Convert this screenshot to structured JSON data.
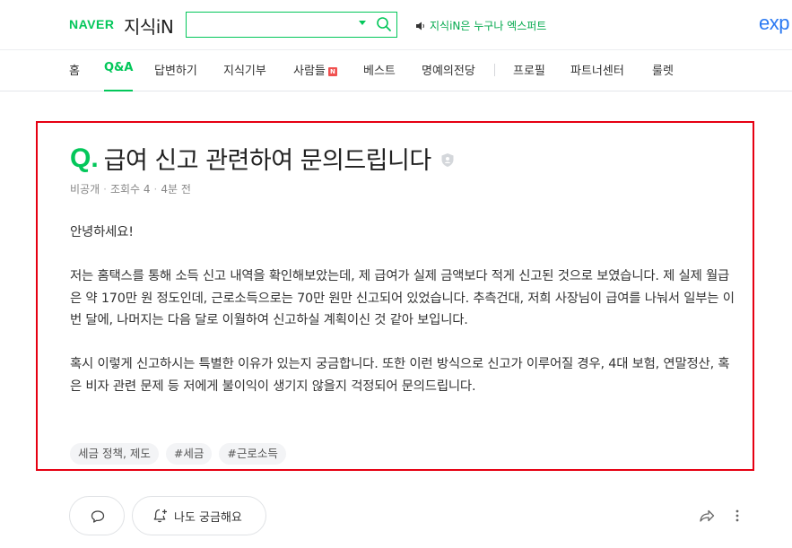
{
  "header": {
    "brand": "NAVER",
    "service": "지식iN",
    "search": {
      "value": "",
      "placeholder": ""
    },
    "promo": "지식iN은 누구나 엑스퍼트",
    "expert_logo": "exp",
    "icons": [
      "search-icon",
      "speaker-icon",
      "dropdown-caret-icon"
    ],
    "accent_color": "#03c75a"
  },
  "nav": {
    "items": [
      {
        "label": "홈"
      },
      {
        "label": "Q&A",
        "active": true
      },
      {
        "label": "답변하기"
      },
      {
        "label": "지식기부"
      },
      {
        "label": "사람들",
        "badge": "N"
      },
      {
        "label": "베스트"
      },
      {
        "label": "명예의전당"
      },
      {
        "label": "프로필"
      },
      {
        "label": "파트너센터"
      },
      {
        "label": "룰렛"
      }
    ]
  },
  "question": {
    "mark": "Q.",
    "title": "급여 신고 관련하여 문의드립니다",
    "meta": {
      "visibility": "비공개",
      "views": "조회수 4",
      "time": "4분 전"
    },
    "body": [
      "안녕하세요!",
      "저는 홈택스를 통해 소득 신고 내역을 확인해보았는데, 제 급여가 실제 금액보다 적게 신고된 것으로 보였습니다. 제 실제 월급은 약 170만 원 정도인데, 근로소득으로는 70만 원만 신고되어 있었습니다. 추측건대, 저희 사장님이 급여를 나눠서 일부는 이번 달에, 나머지는 다음 달로 이월하여 신고하실 계획이신 것 같아 보입니다.",
      "혹시 이렇게 신고하시는 특별한 이유가 있는지 궁금합니다. 또한 이런 방식으로 신고가 이루어질 경우, 4대 보험, 연말정산, 혹은 비자 관련 문제 등 저에게 불이익이 생기지 않을지 걱정되어 문의드립니다."
    ],
    "tags": [
      "세금 정책, 제도",
      "#세금",
      "#근로소득"
    ],
    "highlight_color": "#e60012"
  },
  "actions": {
    "curious_label": "나도 궁금해요",
    "icons": [
      "comment-icon",
      "bell-plus-icon",
      "share-icon",
      "more-icon"
    ]
  }
}
